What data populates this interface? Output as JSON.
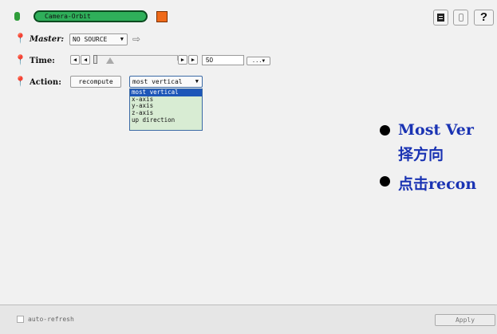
{
  "module": {
    "name": "Camera-Orbit",
    "color": "#ef6a1a"
  },
  "toolbar": {
    "button3_label": "?"
  },
  "master": {
    "label": "Master:",
    "value": "NO SOURCE"
  },
  "time": {
    "label": "Time:",
    "value": "50",
    "more_label": "...",
    "slider_fraction": 0.0
  },
  "action": {
    "label": "Action:",
    "recompute_label": "recompute",
    "selected": "most vertical",
    "options": [
      "most vertical",
      "x-axis",
      "y-axis",
      "z-axis",
      "up direction"
    ]
  },
  "notes": {
    "line1": "Most Ver",
    "line1_cont": "择方向",
    "line2_prefix": "点击",
    "line2_bold": "recon"
  },
  "footer": {
    "auto_refresh_label": "auto-refresh",
    "apply_label": "Apply"
  }
}
